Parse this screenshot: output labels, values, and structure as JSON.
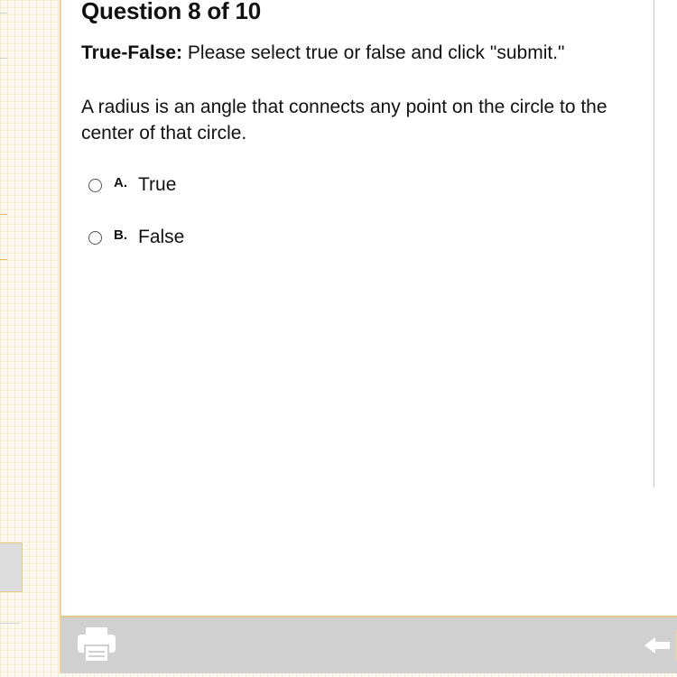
{
  "question": {
    "title": "Question 8 of 10",
    "type_label": "True-False:",
    "instructions": "Please select true or false and click \"submit.\"",
    "text": "A radius is an angle that connects any point on the circle to the center of that circle."
  },
  "options": [
    {
      "letter": "A.",
      "label": "True",
      "selected": false
    },
    {
      "letter": "B.",
      "label": "False",
      "selected": false
    }
  ],
  "toolbar": {
    "print_icon": "printer-icon",
    "back_icon": "back-arrow-icon"
  },
  "colors": {
    "background": "#fbf8ee",
    "border_accent": "#ecd29a",
    "toolbar": "#d0d0d0"
  }
}
